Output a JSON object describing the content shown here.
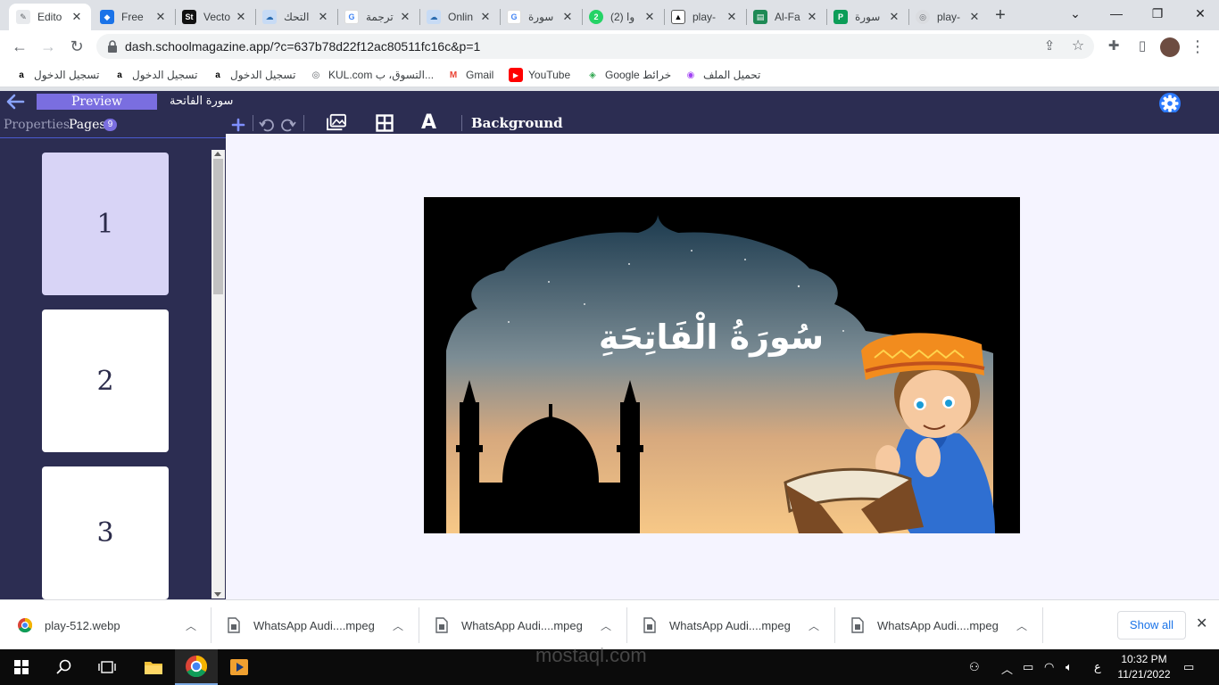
{
  "browser": {
    "tabs": [
      {
        "title": "Edito",
        "favicon": "editor-icon",
        "active": true
      },
      {
        "title": "Free",
        "favicon": "shield-icon"
      },
      {
        "title": "Vecto",
        "favicon": "st-icon"
      },
      {
        "title": "التحك",
        "favicon": "cloud-icon"
      },
      {
        "title": "ترجمة",
        "favicon": "google-icon"
      },
      {
        "title": "Onlin",
        "favicon": "cloud-icon"
      },
      {
        "title": "سورة",
        "favicon": "google-icon"
      },
      {
        "title": "(2) وا",
        "favicon": "whatsapp-icon"
      },
      {
        "title": "play-",
        "favicon": "drive-icon"
      },
      {
        "title": "Al-Fa",
        "favicon": "book-icon"
      },
      {
        "title": "سورة",
        "favicon": "page-icon"
      },
      {
        "title": "play-",
        "favicon": "globe-icon"
      }
    ],
    "new_tab_label": "+",
    "url": "dash.schoolmagazine.app/?c=637b78d22f12ac80511fc16c&p=1",
    "bookmarks": [
      {
        "label": "تسجيل الدخول",
        "icon": "amazon-icon"
      },
      {
        "label": "تسجيل الدخول",
        "icon": "amazon-icon"
      },
      {
        "label": "تسجيل الدخول",
        "icon": "amazon-icon"
      },
      {
        "label": "KUL.com التسوق، ب...",
        "icon": "globe-icon"
      },
      {
        "label": "Gmail",
        "icon": "gmail-icon"
      },
      {
        "label": "YouTube",
        "icon": "youtube-icon"
      },
      {
        "label": "Google خرائط",
        "icon": "maps-icon"
      },
      {
        "label": "تحميل الملف",
        "icon": "upload-icon"
      }
    ]
  },
  "app": {
    "preview_label": "Preview",
    "document_title": "سورة الفاتحة",
    "sidebar": {
      "properties_tab": "Properties",
      "pages_tab": "Pages",
      "pages_count": "9",
      "pages": [
        {
          "label": "1",
          "selected": true
        },
        {
          "label": "2",
          "selected": false
        },
        {
          "label": "3",
          "selected": false
        }
      ]
    },
    "toolbar": {
      "background_label": "Background"
    },
    "canvas": {
      "title": "سُورَةُ الْفَاتِحَةِ",
      "sky_top": "#1c3a4e",
      "sky_bottom": "#f7c887"
    },
    "colors": {
      "appbar": "#2c2d52",
      "accent": "#7a6ee0"
    }
  },
  "downloads": {
    "items": [
      {
        "name": "play-512.webp",
        "icon": "chrome-icon"
      },
      {
        "name": "WhatsApp Audi....mpeg",
        "icon": "file-icon"
      },
      {
        "name": "WhatsApp Audi....mpeg",
        "icon": "file-icon"
      },
      {
        "name": "WhatsApp Audi....mpeg",
        "icon": "file-icon"
      },
      {
        "name": "WhatsApp Audi....mpeg",
        "icon": "file-icon"
      }
    ],
    "show_all_label": "Show all",
    "watermark": "mostaql.com"
  },
  "taskbar": {
    "time": "10:32 PM",
    "date": "11/21/2022",
    "lang": "ع"
  }
}
